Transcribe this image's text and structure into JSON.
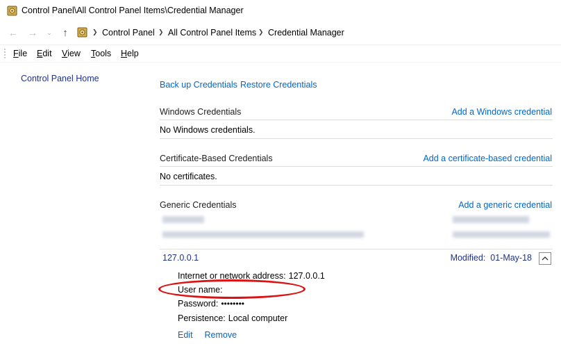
{
  "window": {
    "title": "Control Panel\\All Control Panel Items\\Credential Manager"
  },
  "navigation": {
    "back_icon": "back-arrow-icon",
    "forward_icon": "forward-arrow-icon",
    "breadcrumbs": [
      "Control Panel",
      "All Control Panel Items",
      "Credential Manager"
    ]
  },
  "menu": {
    "items": [
      {
        "label": "File",
        "accel": "F",
        "rest": "ile"
      },
      {
        "label": "Edit",
        "accel": "E",
        "rest": "dit"
      },
      {
        "label": "View",
        "accel": "V",
        "rest": "iew"
      },
      {
        "label": "Tools",
        "accel": "T",
        "rest": "ools"
      },
      {
        "label": "Help",
        "accel": "H",
        "rest": "elp"
      }
    ]
  },
  "sidebar": {
    "home_link": "Control Panel Home"
  },
  "actions_top": {
    "backup": "Back up Credentials",
    "restore": "Restore Credentials"
  },
  "sections": {
    "windows": {
      "title": "Windows Credentials",
      "add_link": "Add a Windows credential",
      "empty": "No Windows credentials."
    },
    "certificate": {
      "title": "Certificate-Based Credentials",
      "add_link": "Add a certificate-based credential",
      "empty": "No certificates."
    },
    "generic": {
      "title": "Generic Credentials",
      "add_link": "Add a generic credential"
    }
  },
  "entry": {
    "name": "127.0.0.1",
    "modified_label": "Modified:",
    "modified_value": "01-May-18",
    "address_label": "Internet or network address:",
    "address_value": "127.0.0.1",
    "username_label": "User name:",
    "password_label": "Password:",
    "password_value": "••••••••",
    "persistence_label": "Persistence:",
    "persistence_value": "Local computer",
    "edit": "Edit",
    "remove": "Remove"
  },
  "colors": {
    "link": "#0066cc",
    "annotation": "#dd1111"
  }
}
